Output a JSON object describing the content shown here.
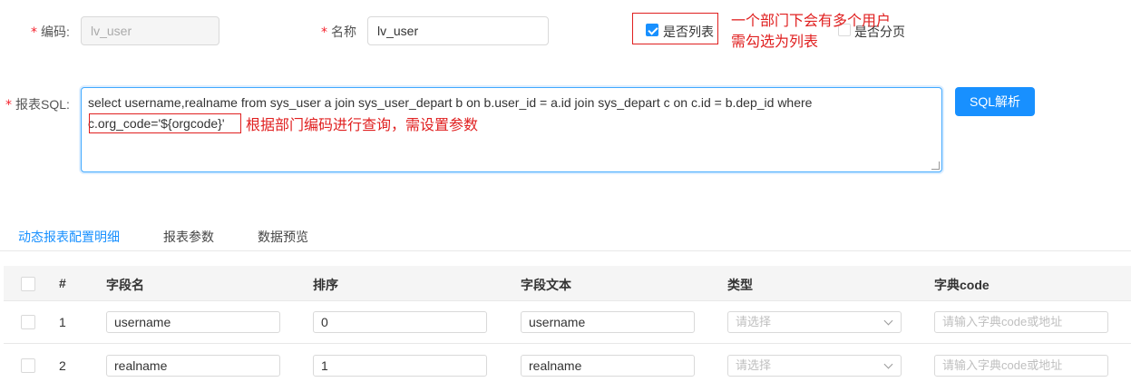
{
  "form": {
    "code_label": "编码:",
    "code_value": "lv_user",
    "name_label": "名称",
    "name_value": "lv_user",
    "is_list_label": "是否列表",
    "is_page_label": "是否分页",
    "sql_label": "报表SQL:",
    "sql_line1": "select username,realname from sys_user a join sys_user_depart b on b.user_id = a.id join sys_depart c on c.id = b.dep_id where",
    "sql_line2": "c.org_code='${orgcode}'",
    "sql_parse_button": "SQL解析"
  },
  "annotations": {
    "list_note_line1": "一个部门下会有多个用户",
    "list_note_line2": "需勾选为列表",
    "sql_note": "根据部门编码进行查询，需设置参数"
  },
  "tabs": [
    "动态报表配置明细",
    "报表参数",
    "数据预览"
  ],
  "table": {
    "headers": [
      "#",
      "字段名",
      "排序",
      "字段文本",
      "类型",
      "字典code"
    ],
    "rows": [
      {
        "index": "1",
        "field": "username",
        "order": "0",
        "text": "username",
        "type_placeholder": "请选择",
        "dict_placeholder": "请输入字典code或地址"
      },
      {
        "index": "2",
        "field": "realname",
        "order": "1",
        "text": "realname",
        "type_placeholder": "请选择",
        "dict_placeholder": "请输入字典code或地址"
      }
    ]
  },
  "colors": {
    "primary": "#1890ff",
    "required": "#f5222d",
    "annotation": "#e02020"
  }
}
